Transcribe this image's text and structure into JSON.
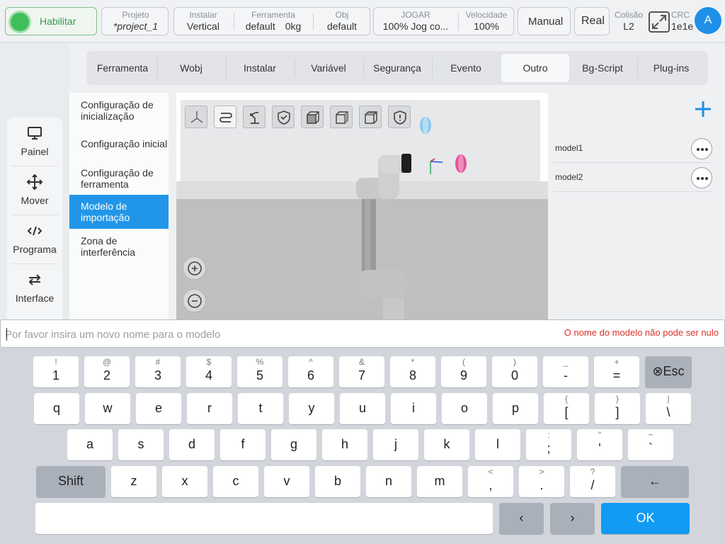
{
  "topbar": {
    "enable_label": "Habilitar",
    "project_label": "Projeto",
    "project_value": "*project_1",
    "install_label": "Instalar",
    "install_value": "Vertical",
    "tool_label": "Ferramenta",
    "tool_value": "default",
    "tool_weight": "0kg",
    "obj_label": "Obj",
    "obj_value": "default",
    "jog_label": "JOGAR",
    "jog_value": "100%  Jog co...",
    "speed_label": "Velocidade",
    "speed_value": "100%",
    "manual_label": "Manual",
    "real_label": "Real",
    "collision_label": "Colisão",
    "collision_value": "L2",
    "crc_label": "CRC",
    "crc_value": "1e1e",
    "avatar_initial": "A"
  },
  "tabs": [
    {
      "label": "Ferramenta"
    },
    {
      "label": "Wobj"
    },
    {
      "label": "Instalar"
    },
    {
      "label": "Variável"
    },
    {
      "label": "Segurança"
    },
    {
      "label": "Evento"
    },
    {
      "label": "Outro"
    },
    {
      "label": "Bg-Script"
    },
    {
      "label": "Plug-ins"
    }
  ],
  "active_tab": "Outro",
  "leftnav": [
    {
      "label": "Painel",
      "icon": "monitor-icon"
    },
    {
      "label": "Mover",
      "icon": "move-arrows-icon"
    },
    {
      "label": "Programa",
      "icon": "code-icon"
    },
    {
      "label": "Interface",
      "icon": "swap-arrows-icon"
    }
  ],
  "submenu": [
    {
      "label": "Configuração de inicialização"
    },
    {
      "label": "Configuração inicial"
    },
    {
      "label": "Configuração de ferramenta"
    },
    {
      "label": "Modelo de importação"
    },
    {
      "label": "Zona de interferência"
    }
  ],
  "active_submenu": "Modelo de importação",
  "models": [
    {
      "name": "model1"
    },
    {
      "name": "model2"
    }
  ],
  "input": {
    "placeholder": "Por favor insira um novo nome para o modelo",
    "value": "",
    "error": "O nome do modelo não pode ser nulo"
  },
  "keyboard": {
    "row1": [
      {
        "main": "1",
        "sec": "!"
      },
      {
        "main": "2",
        "sec": "@"
      },
      {
        "main": "3",
        "sec": "#"
      },
      {
        "main": "4",
        "sec": "$"
      },
      {
        "main": "5",
        "sec": "%"
      },
      {
        "main": "6",
        "sec": "^"
      },
      {
        "main": "7",
        "sec": "&"
      },
      {
        "main": "8",
        "sec": "*"
      },
      {
        "main": "9",
        "sec": "("
      },
      {
        "main": "0",
        "sec": ")"
      },
      {
        "main": "-",
        "sec": "_"
      },
      {
        "main": "=",
        "sec": "+"
      }
    ],
    "esc_label": "⊗Esc",
    "row2": [
      {
        "main": "q"
      },
      {
        "main": "w"
      },
      {
        "main": "e"
      },
      {
        "main": "r"
      },
      {
        "main": "t"
      },
      {
        "main": "y"
      },
      {
        "main": "u"
      },
      {
        "main": "i"
      },
      {
        "main": "o"
      },
      {
        "main": "p"
      },
      {
        "main": "[",
        "sec": "{"
      },
      {
        "main": "]",
        "sec": "}"
      },
      {
        "main": "\\",
        "sec": "|"
      }
    ],
    "row3": [
      {
        "main": "a"
      },
      {
        "main": "s"
      },
      {
        "main": "d"
      },
      {
        "main": "f"
      },
      {
        "main": "g"
      },
      {
        "main": "h"
      },
      {
        "main": "j"
      },
      {
        "main": "k"
      },
      {
        "main": "l"
      },
      {
        "main": ";",
        "sec": ":"
      },
      {
        "main": "'",
        "sec": "\""
      },
      {
        "main": "`",
        "sec": "~"
      }
    ],
    "shift_label": "Shift",
    "row4": [
      {
        "main": "z"
      },
      {
        "main": "x"
      },
      {
        "main": "c"
      },
      {
        "main": "v"
      },
      {
        "main": "b"
      },
      {
        "main": "n"
      },
      {
        "main": "m"
      },
      {
        "main": ",",
        "sec": "<"
      },
      {
        "main": ".",
        "sec": ">"
      },
      {
        "main": "/",
        "sec": "?"
      }
    ],
    "backspace_label": "←",
    "left_label": "‹",
    "right_label": "›",
    "ok_label": "OK"
  },
  "colors": {
    "accent": "#2196e8",
    "enable_green": "#3fbf5a",
    "error_red": "#d9322b",
    "ok_blue": "#129bf2"
  }
}
